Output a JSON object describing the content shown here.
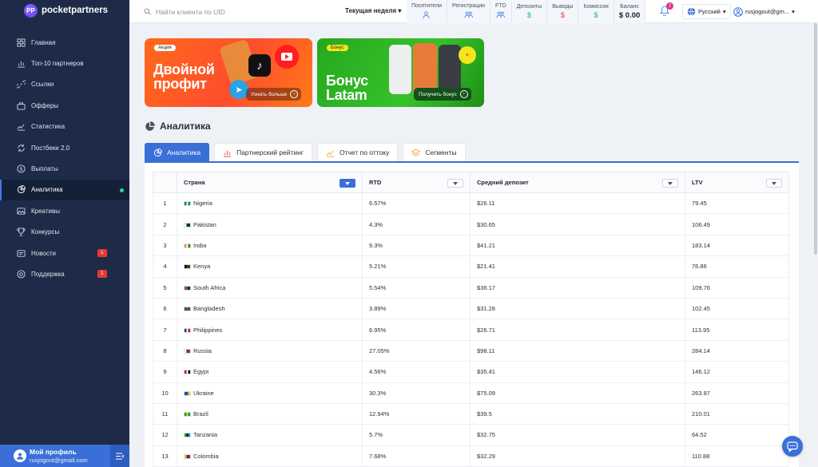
{
  "brand": {
    "name": "pocketpartners",
    "mark": "PP"
  },
  "sidebar": {
    "items": [
      {
        "label": "Главная",
        "icon": "dashboard-icon"
      },
      {
        "label": "Топ-10 партнеров",
        "icon": "chart-icon"
      },
      {
        "label": "Ссылки",
        "icon": "link-icon"
      },
      {
        "label": "Офферы",
        "icon": "briefcase-icon"
      },
      {
        "label": "Статистика",
        "icon": "line-chart-icon"
      },
      {
        "label": "Постбеки 2.0",
        "icon": "postback-icon"
      },
      {
        "label": "Выплаты",
        "icon": "dollar-icon"
      },
      {
        "label": "Аналитика",
        "icon": "pie-chart-icon",
        "active": true
      },
      {
        "label": "Креативы",
        "icon": "image-icon"
      },
      {
        "label": "Конкурсы",
        "icon": "trophy-icon"
      },
      {
        "label": "Новости",
        "icon": "news-icon",
        "badge": "1"
      },
      {
        "label": "Поддержка",
        "icon": "support-icon",
        "badge": "1"
      }
    ]
  },
  "profile": {
    "name": "Мой профиль",
    "email": "rusjogout@gmail.com"
  },
  "topbar": {
    "search_placeholder": "Найти клиента по UID",
    "period": "Текущая неделя",
    "stats": [
      {
        "label": "Посетители",
        "type": "icon",
        "icon": "user-icon"
      },
      {
        "label": "Регистрации",
        "type": "icon",
        "icon": "users-icon"
      },
      {
        "label": "FTD",
        "type": "icon",
        "icon": "users-icon"
      },
      {
        "label": "Депозиты",
        "type": "value",
        "value": "$",
        "tone": "green"
      },
      {
        "label": "Выводы",
        "type": "value",
        "value": "$",
        "tone": "red"
      },
      {
        "label": "Комиссия",
        "type": "value",
        "value": "$",
        "tone": "green"
      }
    ],
    "balance_label": "Баланс",
    "balance_value": "$ 0.00",
    "notifications": "2",
    "language": "Русский",
    "user": "rusjogout@gm..."
  },
  "banners": [
    {
      "tag": "Акция",
      "title_line1": "Двойной",
      "title_line2": "профит",
      "button": "Узнать больше"
    },
    {
      "tag": "Бонус",
      "title_line1": "Бонус",
      "title_line2": "Latam",
      "button": "Получить бонус"
    }
  ],
  "section_title": "Аналитика",
  "tabs": [
    {
      "label": "Аналитика",
      "active": true
    },
    {
      "label": "Партнерский рейтинг"
    },
    {
      "label": "Отчет по оттоку"
    },
    {
      "label": "Сегменты"
    }
  ],
  "table": {
    "headers": [
      "Страна",
      "RTD",
      "Средний депозит",
      "LTV"
    ],
    "rows": [
      {
        "n": "1",
        "country": "Nigeria",
        "rtd": "6.57%",
        "dep": "$26.11",
        "ltv": "79.45",
        "flag": [
          "#008751",
          "#ffffff",
          "#008751"
        ]
      },
      {
        "n": "2",
        "country": "Pakistan",
        "rtd": "4.3%",
        "dep": "$30.65",
        "ltv": "106.49",
        "flag": [
          "#ffffff",
          "#01411c",
          "#01411c"
        ]
      },
      {
        "n": "3",
        "country": "India",
        "rtd": "9.3%",
        "dep": "$41.21",
        "ltv": "183.14",
        "flag": [
          "#ff9933",
          "#ffffff",
          "#138808"
        ]
      },
      {
        "n": "4",
        "country": "Kenya",
        "rtd": "5.21%",
        "dep": "$21.41",
        "ltv": "76.86",
        "flag": [
          "#000000",
          "#bb0000",
          "#006600"
        ]
      },
      {
        "n": "5",
        "country": "South Africa",
        "rtd": "5.54%",
        "dep": "$36.17",
        "ltv": "109.76",
        "flag": [
          "#de3831",
          "#007a4d",
          "#002395"
        ]
      },
      {
        "n": "6",
        "country": "Bangladesh",
        "rtd": "3.89%",
        "dep": "$31.28",
        "ltv": "102.45",
        "flag": [
          "#006a4e",
          "#f42a41",
          "#006a4e"
        ]
      },
      {
        "n": "7",
        "country": "Philippines",
        "rtd": "6.95%",
        "dep": "$26.71",
        "ltv": "113.95",
        "flag": [
          "#0038a8",
          "#ffffff",
          "#ce1126"
        ]
      },
      {
        "n": "8",
        "country": "Russia",
        "rtd": "27.05%",
        "dep": "$98.11",
        "ltv": "284.14",
        "flag": [
          "#ffffff",
          "#0039a6",
          "#d52b1e"
        ]
      },
      {
        "n": "9",
        "country": "Egypt",
        "rtd": "4.56%",
        "dep": "$35.41",
        "ltv": "146.12",
        "flag": [
          "#ce1126",
          "#ffffff",
          "#000000"
        ]
      },
      {
        "n": "10",
        "country": "Ukraine",
        "rtd": "30.3%",
        "dep": "$75.09",
        "ltv": "263.87",
        "flag": [
          "#0057b7",
          "#0057b7",
          "#ffd700"
        ]
      },
      {
        "n": "11",
        "country": "Brazil",
        "rtd": "12.94%",
        "dep": "$39.5",
        "ltv": "210.01",
        "flag": [
          "#009c3b",
          "#ffdf00",
          "#009c3b"
        ]
      },
      {
        "n": "12",
        "country": "Tanzania",
        "rtd": "5.7%",
        "dep": "$32.75",
        "ltv": "64.52",
        "flag": [
          "#1eb53a",
          "#000000",
          "#00a3dd"
        ]
      },
      {
        "n": "13",
        "country": "Colombia",
        "rtd": "7.68%",
        "dep": "$32.29",
        "ltv": "110.88",
        "flag": [
          "#fcd116",
          "#003893",
          "#ce1126"
        ]
      }
    ]
  }
}
